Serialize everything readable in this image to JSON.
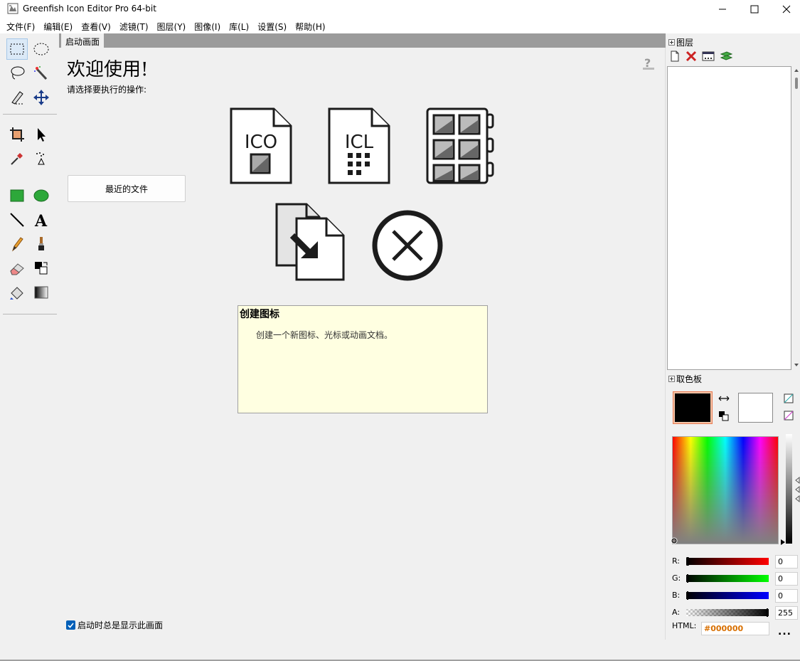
{
  "titlebar": {
    "title": "Greenfish Icon Editor Pro 64-bit"
  },
  "menu": [
    "文件(F)",
    "编辑(E)",
    "查看(V)",
    "滤镜(T)",
    "图层(Y)",
    "图像(I)",
    "库(L)",
    "设置(S)",
    "帮助(H)"
  ],
  "tab": {
    "label": "启动画面"
  },
  "welcome": {
    "title": "欢迎使用!",
    "subtitle": "请选择要执行的操作:",
    "recent_button": "最近的文件",
    "info_title": "创建图标",
    "info_desc": "创建一个新图标、光标或动画文档。",
    "checkbox_label": "启动时总是显示此画面",
    "checkbox_checked": true,
    "icon_ico_label": "ICO",
    "icon_icl_label": "ICL"
  },
  "layers": {
    "header": "图层"
  },
  "palette": {
    "header": "取色板",
    "fg_color": "#000000",
    "bg_color": "#ffffff",
    "r_label": "R:",
    "r_value": "0",
    "g_label": "G:",
    "g_value": "0",
    "b_label": "B:",
    "b_value": "0",
    "a_label": "A:",
    "a_value": "255",
    "html_label": "HTML:",
    "html_value": "#000000",
    "more": "..."
  },
  "colors": {
    "accent": "#005fb8",
    "info_bg": "#ffffe1",
    "fg_highlight": "#e87a52"
  }
}
